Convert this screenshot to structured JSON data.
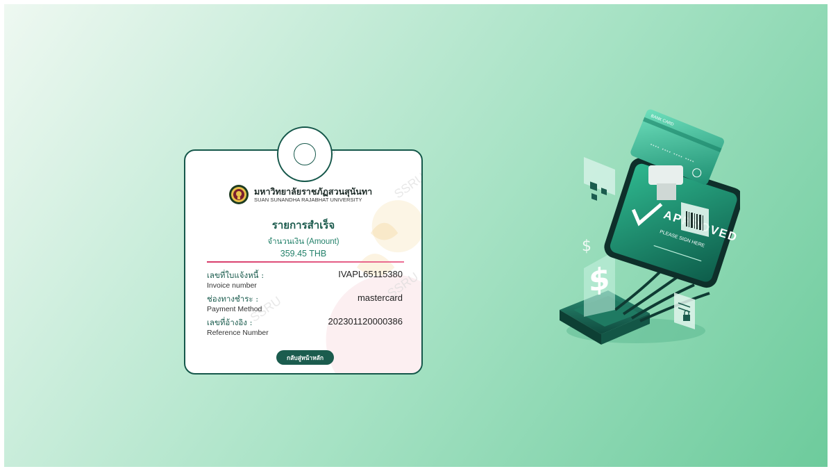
{
  "status": {
    "icon": "success-circle-icon"
  },
  "university": {
    "name_th": "มหาวิทยาลัยราชภัฏสวนสุนันทา",
    "name_en": "SUAN SUNANDHA RAJABHAT UNIVERSITY",
    "logo": "university-emblem-icon",
    "watermark": "SSRU"
  },
  "receipt": {
    "title": "รายการสำเร็จ",
    "amount_label": "จำนวนเงิน (Amount)",
    "amount_value": "359.45 THB",
    "rows": [
      {
        "label_th": "เลขที่ใบแจ้งหนี้ :",
        "label_en": "Invoice number",
        "value": "IVAPL65115380"
      },
      {
        "label_th": "ช่องทางชำระ :",
        "label_en": "Payment Method",
        "value": "mastercard"
      },
      {
        "label_th": "เลขที่อ้างอิง :",
        "label_en": "Reference Number",
        "value": "202301120000386"
      }
    ],
    "back_button": "กลับสู่หน้าหลัก"
  },
  "illustration": {
    "approved_text": "APPROVED",
    "sign_text": "PLEASE SIGN HERE",
    "card_text": "BANK CARD",
    "card_number": "**** **** **** ****",
    "currency_symbol": "$",
    "colors": {
      "accent": "#1b5c4e",
      "teal": "#23a384",
      "pink": "#d73b6a"
    }
  }
}
